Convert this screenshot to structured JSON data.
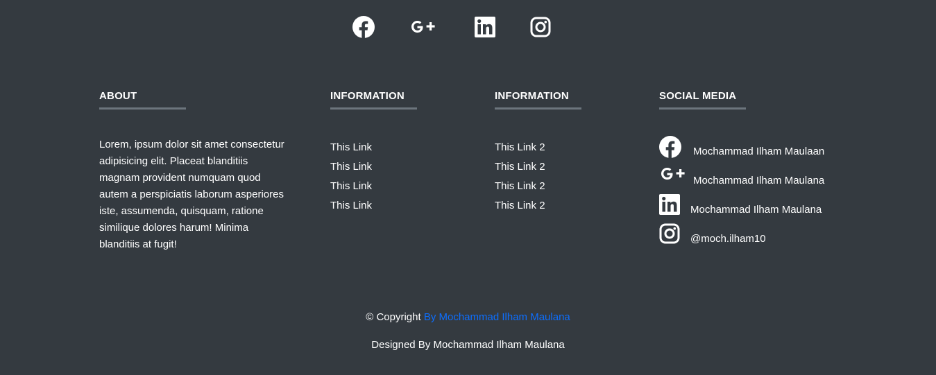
{
  "top_social": [
    {
      "icon": "facebook-icon"
    },
    {
      "icon": "google-plus-icon"
    },
    {
      "icon": "linkedin-icon"
    },
    {
      "icon": "instagram-icon"
    }
  ],
  "about": {
    "heading": "ABOUT",
    "text": "Lorem, ipsum dolor sit amet consectetur adipisicing elit. Placeat blanditiis magnam provident numquam quod autem a perspiciatis laborum asperiores iste, assumenda, quisquam, ratione similique dolores harum! Minima blanditiis at fugit!"
  },
  "info1": {
    "heading": "INFORMATION",
    "links": [
      "This Link",
      "This Link",
      "This Link",
      "This Link"
    ]
  },
  "info2": {
    "heading": "INFORMATION",
    "links": [
      "This Link 2",
      "This Link 2",
      "This Link 2",
      "This Link 2"
    ]
  },
  "social_media": {
    "heading": "SOCIAL MEDIA",
    "items": [
      {
        "icon": "facebook-icon",
        "label": "Mochammad Ilham Maulaan"
      },
      {
        "icon": "google-plus-icon",
        "label": "Mochammad Ilham Maulana"
      },
      {
        "icon": "linkedin-icon",
        "label": "Mochammad Ilham Maulana"
      },
      {
        "icon": "instagram-icon",
        "label": "@moch.ilham10"
      }
    ]
  },
  "footer": {
    "copyright_prefix": "© Copyright",
    "copyright_link": "By Mochammad Ilham Maulana",
    "designed_by": "Designed By Mochammad Ilham Maulana"
  },
  "colors": {
    "background": "#343a40",
    "text": "#ffffff",
    "link": "#0d6efd",
    "underline": "#6c757d"
  }
}
